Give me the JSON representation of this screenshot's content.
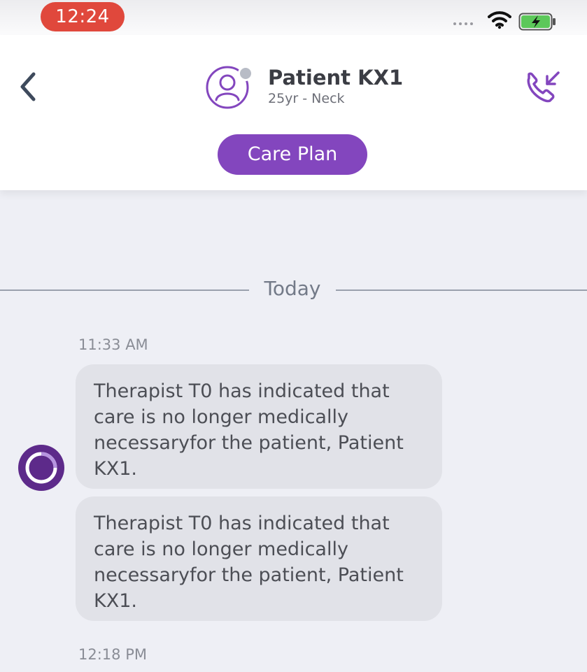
{
  "status_bar": {
    "time": "12:24"
  },
  "header": {
    "patient_name": "Patient KX1",
    "patient_details": "25yr - Neck",
    "care_plan_label": "Care Plan"
  },
  "chat": {
    "date_divider": "Today",
    "groups": [
      {
        "timestamp": "11:33 AM",
        "messages": [
          "Therapist T0 has indicated that care is no longer medically necessaryfor the patient, Patient KX1.",
          "Therapist T0 has indicated that care is no longer medically necessaryfor the patient, Patient KX1."
        ]
      },
      {
        "timestamp": "12:18 PM",
        "messages": []
      }
    ]
  },
  "icons": {
    "back": "chevron-left-icon",
    "avatar": "user-avatar-icon",
    "call": "incoming-call-icon",
    "wifi": "wifi-icon",
    "battery": "battery-charging-icon",
    "sender": "app-logo-icon"
  },
  "colors": {
    "accent": "#8346be",
    "status_time_pill": "#e0483c",
    "battery_fill": "#5cc85a",
    "chat_background": "#eeeff5",
    "bubble_background": "#e1e2e8"
  }
}
